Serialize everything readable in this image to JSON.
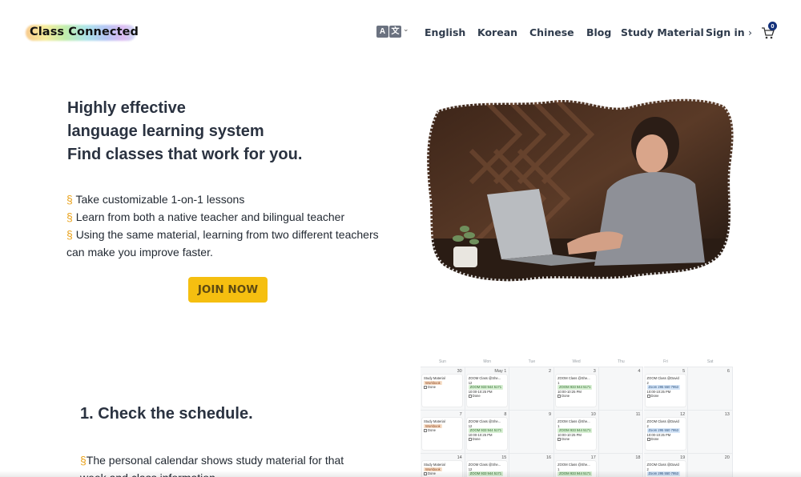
{
  "header": {
    "logo_text": "Class Connected",
    "lang_icon_left": "A",
    "lang_icon_right": "文",
    "nav": [
      "English",
      "Korean",
      "Chinese",
      "Blog",
      "Study Material",
      "Sign in"
    ],
    "sign_in_chevron": "›",
    "cart_count": "0"
  },
  "hero": {
    "title_lines": [
      "Highly effective",
      "language learning system",
      "Find classes that work for you."
    ],
    "bullet_mark": "§",
    "bullets": [
      "Take customizable 1-on-1 lessons",
      "Learn from both a native teacher and bilingual teacher",
      "Using the same material, learning from two different teachers can make you improve faster."
    ],
    "cta": "JOIN NOW"
  },
  "schedule": {
    "title": "1. Check the schedule.",
    "bullet_mark": "§",
    "text": "The personal calendar shows study material for that week and class information."
  },
  "calendar": {
    "weekdays": [
      "Sun",
      "Mon",
      "Tue",
      "Wed",
      "Thu",
      "Fri",
      "Sat"
    ],
    "weeks": [
      [
        "30",
        "May 1",
        "2",
        "3",
        "4",
        "5",
        "6"
      ],
      [
        "7",
        "8",
        "9",
        "10",
        "11",
        "12",
        "13"
      ],
      [
        "14",
        "15",
        "16",
        "17",
        "18",
        "19",
        "20"
      ]
    ],
    "study_title": "Study Material",
    "workbook": "Workbook",
    "done": "Done",
    "zoom_class_she": "ZOOM Class @She...",
    "zoom_class_david": "ZOOM Class @David",
    "zoom_green": "ZOOM 933 944 5171",
    "zoom_blue": "Zoom 295 550 7953",
    "time": "10:00-10:25 PM",
    "session_a": "12",
    "session_b": "1",
    "session_c": "2"
  },
  "colors": {
    "accent": "#f5bf10",
    "bullet": "#e9a21b",
    "heading": "#2a3240",
    "badge": "#13317a"
  },
  "icons": [
    "translate-icon",
    "chevron-down-icon",
    "chevron-right-icon",
    "cart-icon"
  ]
}
